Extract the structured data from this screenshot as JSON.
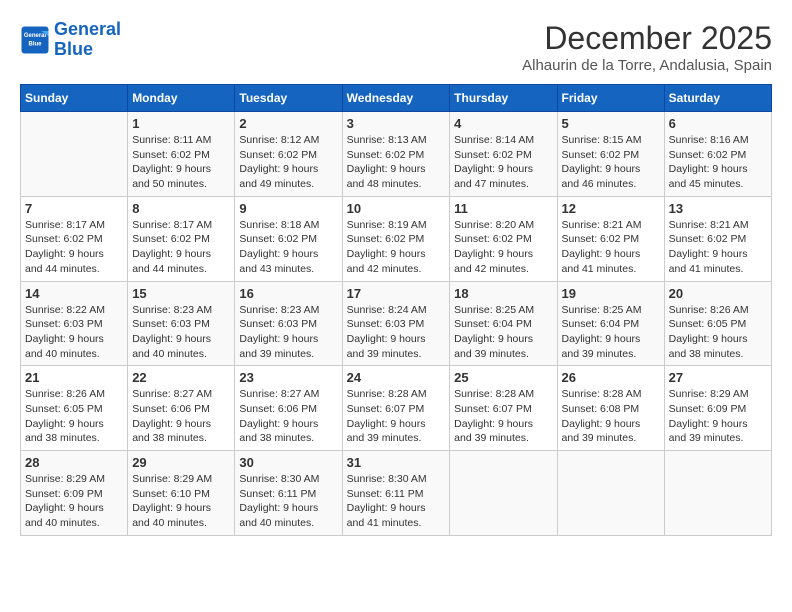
{
  "header": {
    "logo_line1": "General",
    "logo_line2": "Blue",
    "month_title": "December 2025",
    "location": "Alhaurin de la Torre, Andalusia, Spain"
  },
  "weekdays": [
    "Sunday",
    "Monday",
    "Tuesday",
    "Wednesday",
    "Thursday",
    "Friday",
    "Saturday"
  ],
  "weeks": [
    [
      {
        "day": "",
        "info": ""
      },
      {
        "day": "1",
        "info": "Sunrise: 8:11 AM\nSunset: 6:02 PM\nDaylight: 9 hours\nand 50 minutes."
      },
      {
        "day": "2",
        "info": "Sunrise: 8:12 AM\nSunset: 6:02 PM\nDaylight: 9 hours\nand 49 minutes."
      },
      {
        "day": "3",
        "info": "Sunrise: 8:13 AM\nSunset: 6:02 PM\nDaylight: 9 hours\nand 48 minutes."
      },
      {
        "day": "4",
        "info": "Sunrise: 8:14 AM\nSunset: 6:02 PM\nDaylight: 9 hours\nand 47 minutes."
      },
      {
        "day": "5",
        "info": "Sunrise: 8:15 AM\nSunset: 6:02 PM\nDaylight: 9 hours\nand 46 minutes."
      },
      {
        "day": "6",
        "info": "Sunrise: 8:16 AM\nSunset: 6:02 PM\nDaylight: 9 hours\nand 45 minutes."
      }
    ],
    [
      {
        "day": "7",
        "info": "Sunrise: 8:17 AM\nSunset: 6:02 PM\nDaylight: 9 hours\nand 44 minutes."
      },
      {
        "day": "8",
        "info": "Sunrise: 8:17 AM\nSunset: 6:02 PM\nDaylight: 9 hours\nand 44 minutes."
      },
      {
        "day": "9",
        "info": "Sunrise: 8:18 AM\nSunset: 6:02 PM\nDaylight: 9 hours\nand 43 minutes."
      },
      {
        "day": "10",
        "info": "Sunrise: 8:19 AM\nSunset: 6:02 PM\nDaylight: 9 hours\nand 42 minutes."
      },
      {
        "day": "11",
        "info": "Sunrise: 8:20 AM\nSunset: 6:02 PM\nDaylight: 9 hours\nand 42 minutes."
      },
      {
        "day": "12",
        "info": "Sunrise: 8:21 AM\nSunset: 6:02 PM\nDaylight: 9 hours\nand 41 minutes."
      },
      {
        "day": "13",
        "info": "Sunrise: 8:21 AM\nSunset: 6:02 PM\nDaylight: 9 hours\nand 41 minutes."
      }
    ],
    [
      {
        "day": "14",
        "info": "Sunrise: 8:22 AM\nSunset: 6:03 PM\nDaylight: 9 hours\nand 40 minutes."
      },
      {
        "day": "15",
        "info": "Sunrise: 8:23 AM\nSunset: 6:03 PM\nDaylight: 9 hours\nand 40 minutes."
      },
      {
        "day": "16",
        "info": "Sunrise: 8:23 AM\nSunset: 6:03 PM\nDaylight: 9 hours\nand 39 minutes."
      },
      {
        "day": "17",
        "info": "Sunrise: 8:24 AM\nSunset: 6:03 PM\nDaylight: 9 hours\nand 39 minutes."
      },
      {
        "day": "18",
        "info": "Sunrise: 8:25 AM\nSunset: 6:04 PM\nDaylight: 9 hours\nand 39 minutes."
      },
      {
        "day": "19",
        "info": "Sunrise: 8:25 AM\nSunset: 6:04 PM\nDaylight: 9 hours\nand 39 minutes."
      },
      {
        "day": "20",
        "info": "Sunrise: 8:26 AM\nSunset: 6:05 PM\nDaylight: 9 hours\nand 38 minutes."
      }
    ],
    [
      {
        "day": "21",
        "info": "Sunrise: 8:26 AM\nSunset: 6:05 PM\nDaylight: 9 hours\nand 38 minutes."
      },
      {
        "day": "22",
        "info": "Sunrise: 8:27 AM\nSunset: 6:06 PM\nDaylight: 9 hours\nand 38 minutes."
      },
      {
        "day": "23",
        "info": "Sunrise: 8:27 AM\nSunset: 6:06 PM\nDaylight: 9 hours\nand 38 minutes."
      },
      {
        "day": "24",
        "info": "Sunrise: 8:28 AM\nSunset: 6:07 PM\nDaylight: 9 hours\nand 39 minutes."
      },
      {
        "day": "25",
        "info": "Sunrise: 8:28 AM\nSunset: 6:07 PM\nDaylight: 9 hours\nand 39 minutes."
      },
      {
        "day": "26",
        "info": "Sunrise: 8:28 AM\nSunset: 6:08 PM\nDaylight: 9 hours\nand 39 minutes."
      },
      {
        "day": "27",
        "info": "Sunrise: 8:29 AM\nSunset: 6:09 PM\nDaylight: 9 hours\nand 39 minutes."
      }
    ],
    [
      {
        "day": "28",
        "info": "Sunrise: 8:29 AM\nSunset: 6:09 PM\nDaylight: 9 hours\nand 40 minutes."
      },
      {
        "day": "29",
        "info": "Sunrise: 8:29 AM\nSunset: 6:10 PM\nDaylight: 9 hours\nand 40 minutes."
      },
      {
        "day": "30",
        "info": "Sunrise: 8:30 AM\nSunset: 6:11 PM\nDaylight: 9 hours\nand 40 minutes."
      },
      {
        "day": "31",
        "info": "Sunrise: 8:30 AM\nSunset: 6:11 PM\nDaylight: 9 hours\nand 41 minutes."
      },
      {
        "day": "",
        "info": ""
      },
      {
        "day": "",
        "info": ""
      },
      {
        "day": "",
        "info": ""
      }
    ]
  ]
}
